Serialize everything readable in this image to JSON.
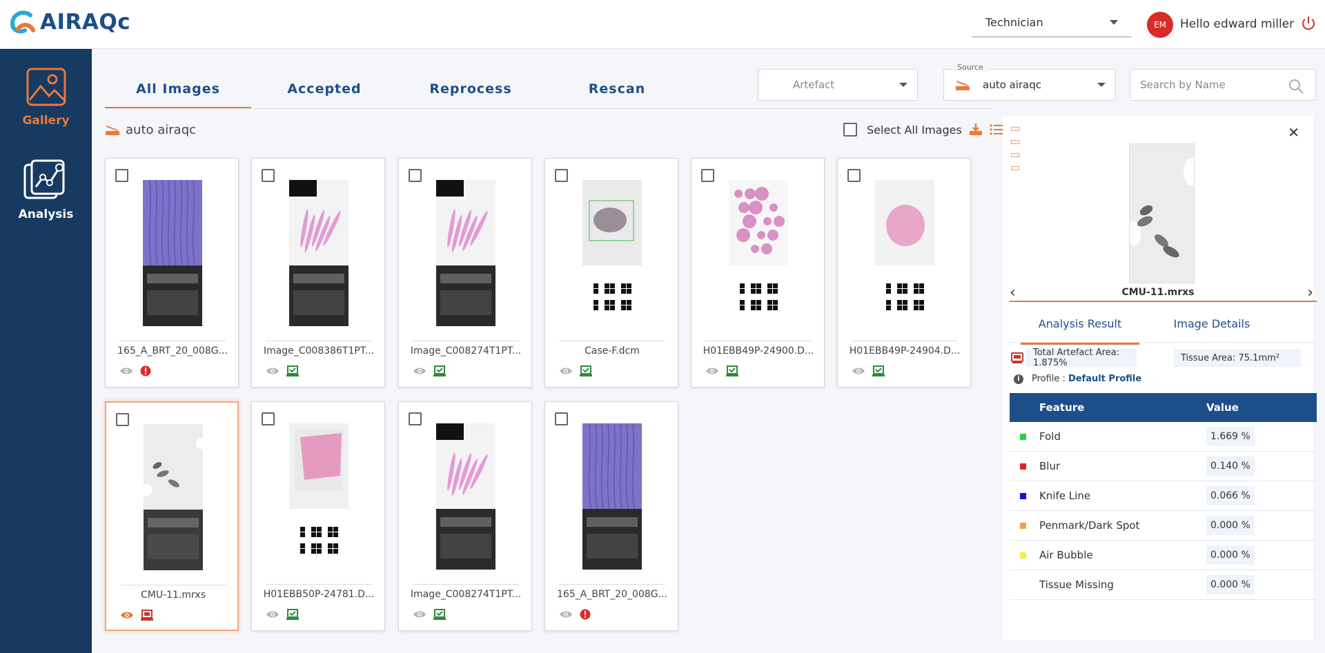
{
  "app": {
    "logo_text": "AIRAQc",
    "role": "Technician",
    "avatar_initials": "EM",
    "greeting": "Hello edward miller"
  },
  "sidebar": {
    "items": [
      {
        "label": "Gallery",
        "active": true
      },
      {
        "label": "Analysis",
        "active": false
      }
    ]
  },
  "tabs": [
    {
      "label": "All Images",
      "active": true
    },
    {
      "label": "Accepted",
      "active": false
    },
    {
      "label": "Reprocess",
      "active": false
    },
    {
      "label": "Rescan",
      "active": false
    }
  ],
  "filters": {
    "artefact_placeholder": "Artefact",
    "source_legend": "Source",
    "source_value": "auto airaqc",
    "search_placeholder": "Search by Name"
  },
  "gallery": {
    "source_label": "auto airaqc",
    "select_all_label": "Select All Images",
    "cards": [
      {
        "name": "165_A_BRT_20_008G...",
        "status": "error",
        "selected": false
      },
      {
        "name": "Image_C008386T1PT...",
        "status": "accepted",
        "selected": false
      },
      {
        "name": "Image_C008274T1PT...",
        "status": "accepted",
        "selected": false
      },
      {
        "name": "Case-F.dcm",
        "status": "accepted",
        "selected": false
      },
      {
        "name": "H01EBB49P-24900.D...",
        "status": "accepted",
        "selected": false
      },
      {
        "name": "H01EBB49P-24904.D...",
        "status": "accepted",
        "selected": false
      },
      {
        "name": "CMU-11.mrxs",
        "status": "reprocess",
        "selected": true
      },
      {
        "name": "H01EBB50P-24781.D...",
        "status": "accepted",
        "selected": false
      },
      {
        "name": "Image_C008274T1PT...",
        "status": "accepted",
        "selected": false
      },
      {
        "name": "165_A_BRT_20_008G...",
        "status": "error",
        "selected": false
      }
    ]
  },
  "detail": {
    "image_name": "CMU-11.mrxs",
    "tabs": [
      {
        "label": "Analysis Result",
        "active": true
      },
      {
        "label": "Image Details",
        "active": false
      }
    ],
    "total_artefact_area": "Total Artefact Area: 1.875%",
    "tissue_area": "Tissue Area: 75.1mm²",
    "profile_label": "Profile :",
    "profile_value": "Default Profile",
    "table_headers": {
      "feature": "Feature",
      "value": "Value"
    },
    "features": [
      {
        "name": "Fold",
        "value": "1.669 %",
        "color": "#22d63a"
      },
      {
        "name": "Blur",
        "value": "0.140 %",
        "color": "#e52525"
      },
      {
        "name": "Knife Line",
        "value": "0.066 %",
        "color": "#1010d8"
      },
      {
        "name": "Penmark/Dark Spot",
        "value": "0.000 %",
        "color": "#f2a33a"
      },
      {
        "name": "Air Bubble",
        "value": "0.000 %",
        "color": "#f5ef3a"
      },
      {
        "name": "Tissue Missing",
        "value": "0.000 %",
        "color": ""
      }
    ]
  },
  "colors": {
    "accent": "#e8793a",
    "brand": "#1d4e89",
    "sidebar": "#173a61",
    "error": "#d92b2b",
    "accepted": "#2e8b3d"
  }
}
